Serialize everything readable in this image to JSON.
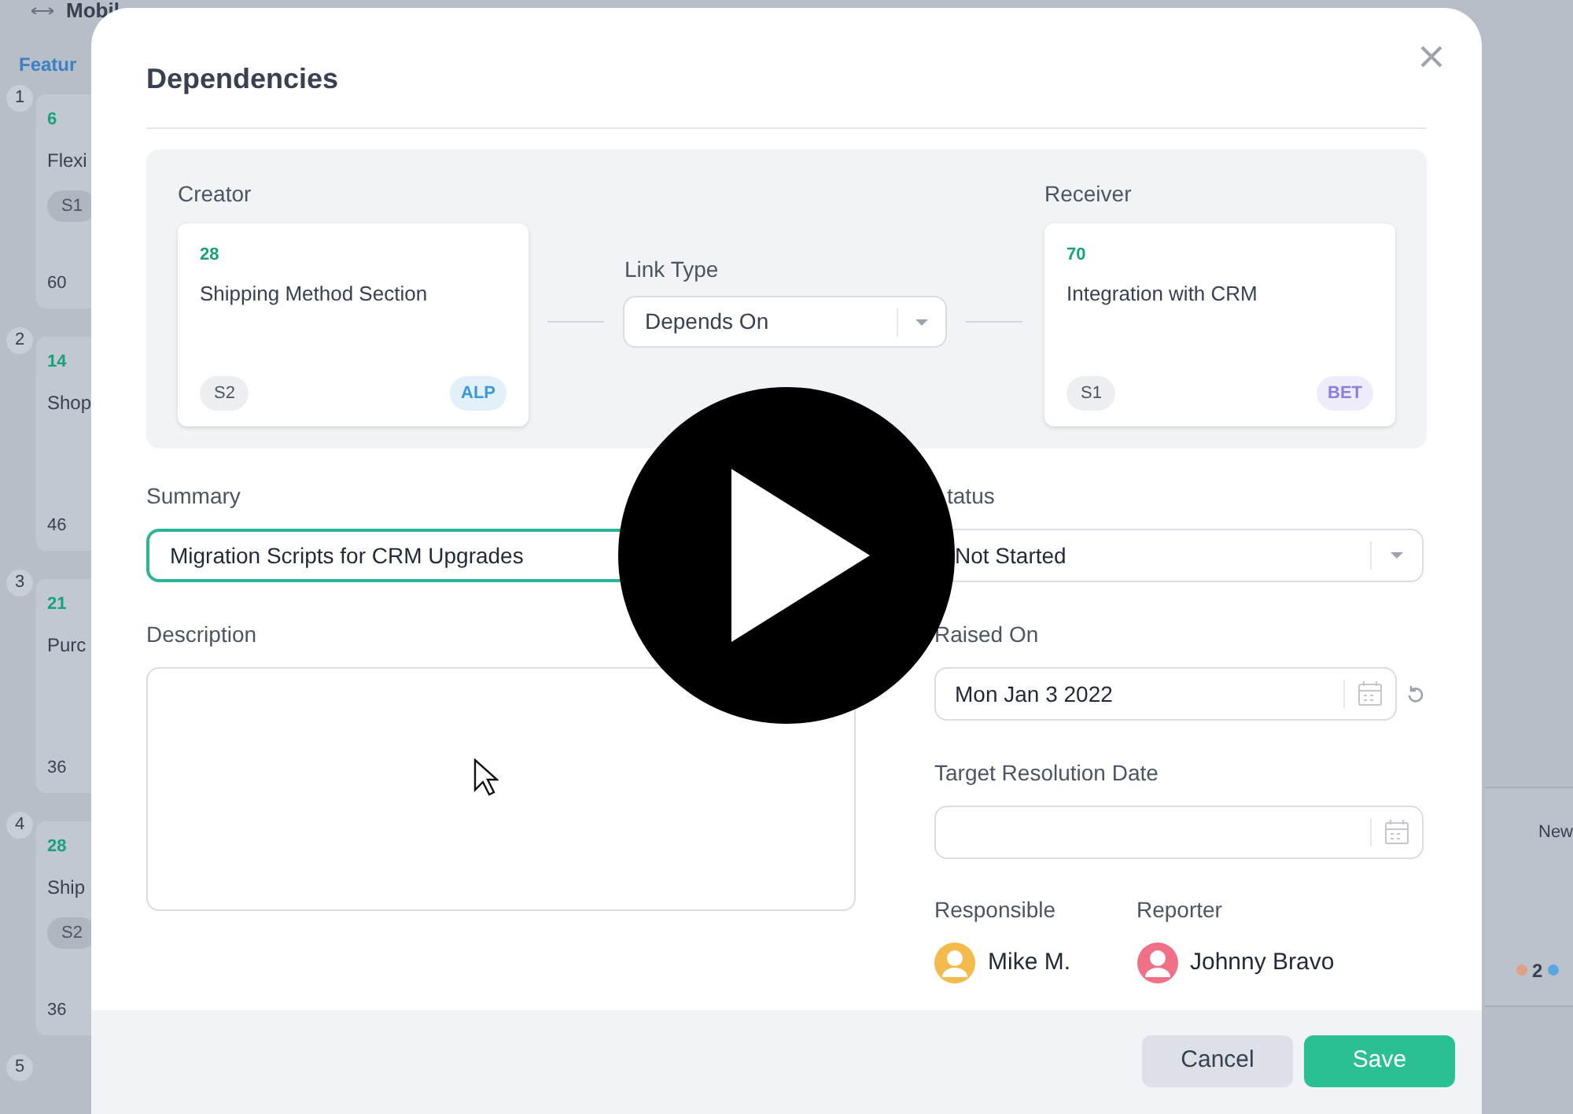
{
  "background": {
    "board_title": "Mobil",
    "tab": "Featur",
    "lanes": [
      {
        "number": "1",
        "card": {
          "id": "6",
          "title": "Flexi",
          "tag": "S1",
          "points": "60"
        }
      },
      {
        "number": "2",
        "card": {
          "id": "14",
          "title": "Shop",
          "points": "46"
        }
      },
      {
        "number": "3",
        "card": {
          "id": "21",
          "title": "Purc",
          "points": "36"
        }
      },
      {
        "number": "4",
        "card": {
          "id": "28",
          "title": "Ship",
          "tag": "S2",
          "points": "36"
        }
      },
      {
        "number": "5"
      }
    ],
    "right_column": {
      "label": "New",
      "dots": [
        {
          "color": "#e0a088"
        },
        {
          "color": "#5aa7e0"
        }
      ],
      "count": "2"
    }
  },
  "dialog": {
    "title": "Dependencies",
    "creator": {
      "label": "Creator",
      "id": "28",
      "title": "Shipping Method Section",
      "tag": "S2",
      "badge": "ALP",
      "color": "#3a9ad6"
    },
    "link_type": {
      "label": "Link Type",
      "value": "Depends On"
    },
    "receiver": {
      "label": "Receiver",
      "id": "70",
      "title": "Integration with CRM",
      "tag": "S1",
      "badge": "BET",
      "color": "#8b7fe0"
    },
    "summary": {
      "label": "Summary",
      "value": "Migration Scripts for CRM Upgrades"
    },
    "status": {
      "label": "tatus",
      "value": "Not Started"
    },
    "description": {
      "label": "Description"
    },
    "raised_on": {
      "label": "Raised On",
      "value": "Mon Jan 3 2022"
    },
    "target_date": {
      "label": "Target Resolution Date"
    },
    "responsible": {
      "label": "Responsible",
      "name": "Mike M.",
      "color": "#f2bb4c"
    },
    "reporter": {
      "label": "Reporter",
      "name": "Johnny Bravo",
      "color": "#f07086"
    },
    "buttons": [
      {
        "label": "Cancel",
        "kind": "secondary"
      },
      {
        "label": "Save",
        "kind": "primary"
      }
    ]
  }
}
